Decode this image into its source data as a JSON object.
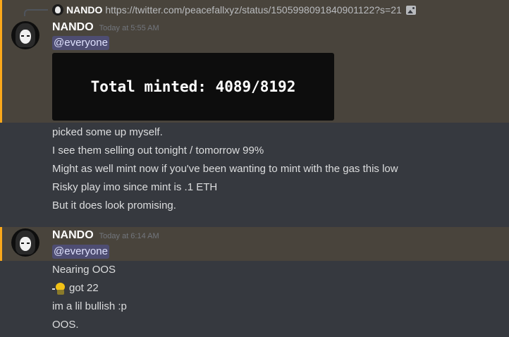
{
  "reply": {
    "author": "NANDO",
    "text": "https://twitter.com/peacefallxyz/status/1505998091840901122?s=21"
  },
  "messages": [
    {
      "author": "NANDO",
      "timestamp": "Today at 5:55 AM",
      "mention": "@everyone",
      "image_text": "Total minted: 4089/8192",
      "lines": [
        "picked some up myself.",
        "I see them selling out tonight / tomorrow 99%",
        "Might as well mint now if you've been wanting to mint with the gas this low",
        "Risky play imo since mint is .1 ETH",
        "But it does look promising."
      ]
    },
    {
      "author": "NANDO",
      "timestamp": "Today at 6:14 AM",
      "mention": "@everyone",
      "lines": [
        "Nearing OOS",
        "got 22",
        "im a lil bullish :p",
        "OOS."
      ]
    }
  ],
  "colors": {
    "background": "#36393f",
    "highlight": "#49443c",
    "highlight_bar": "#faa81a",
    "mention_text": "#dee0fc"
  },
  "icons": {
    "reply_image": "image-icon",
    "emoji": "bot-emoji-icon"
  }
}
